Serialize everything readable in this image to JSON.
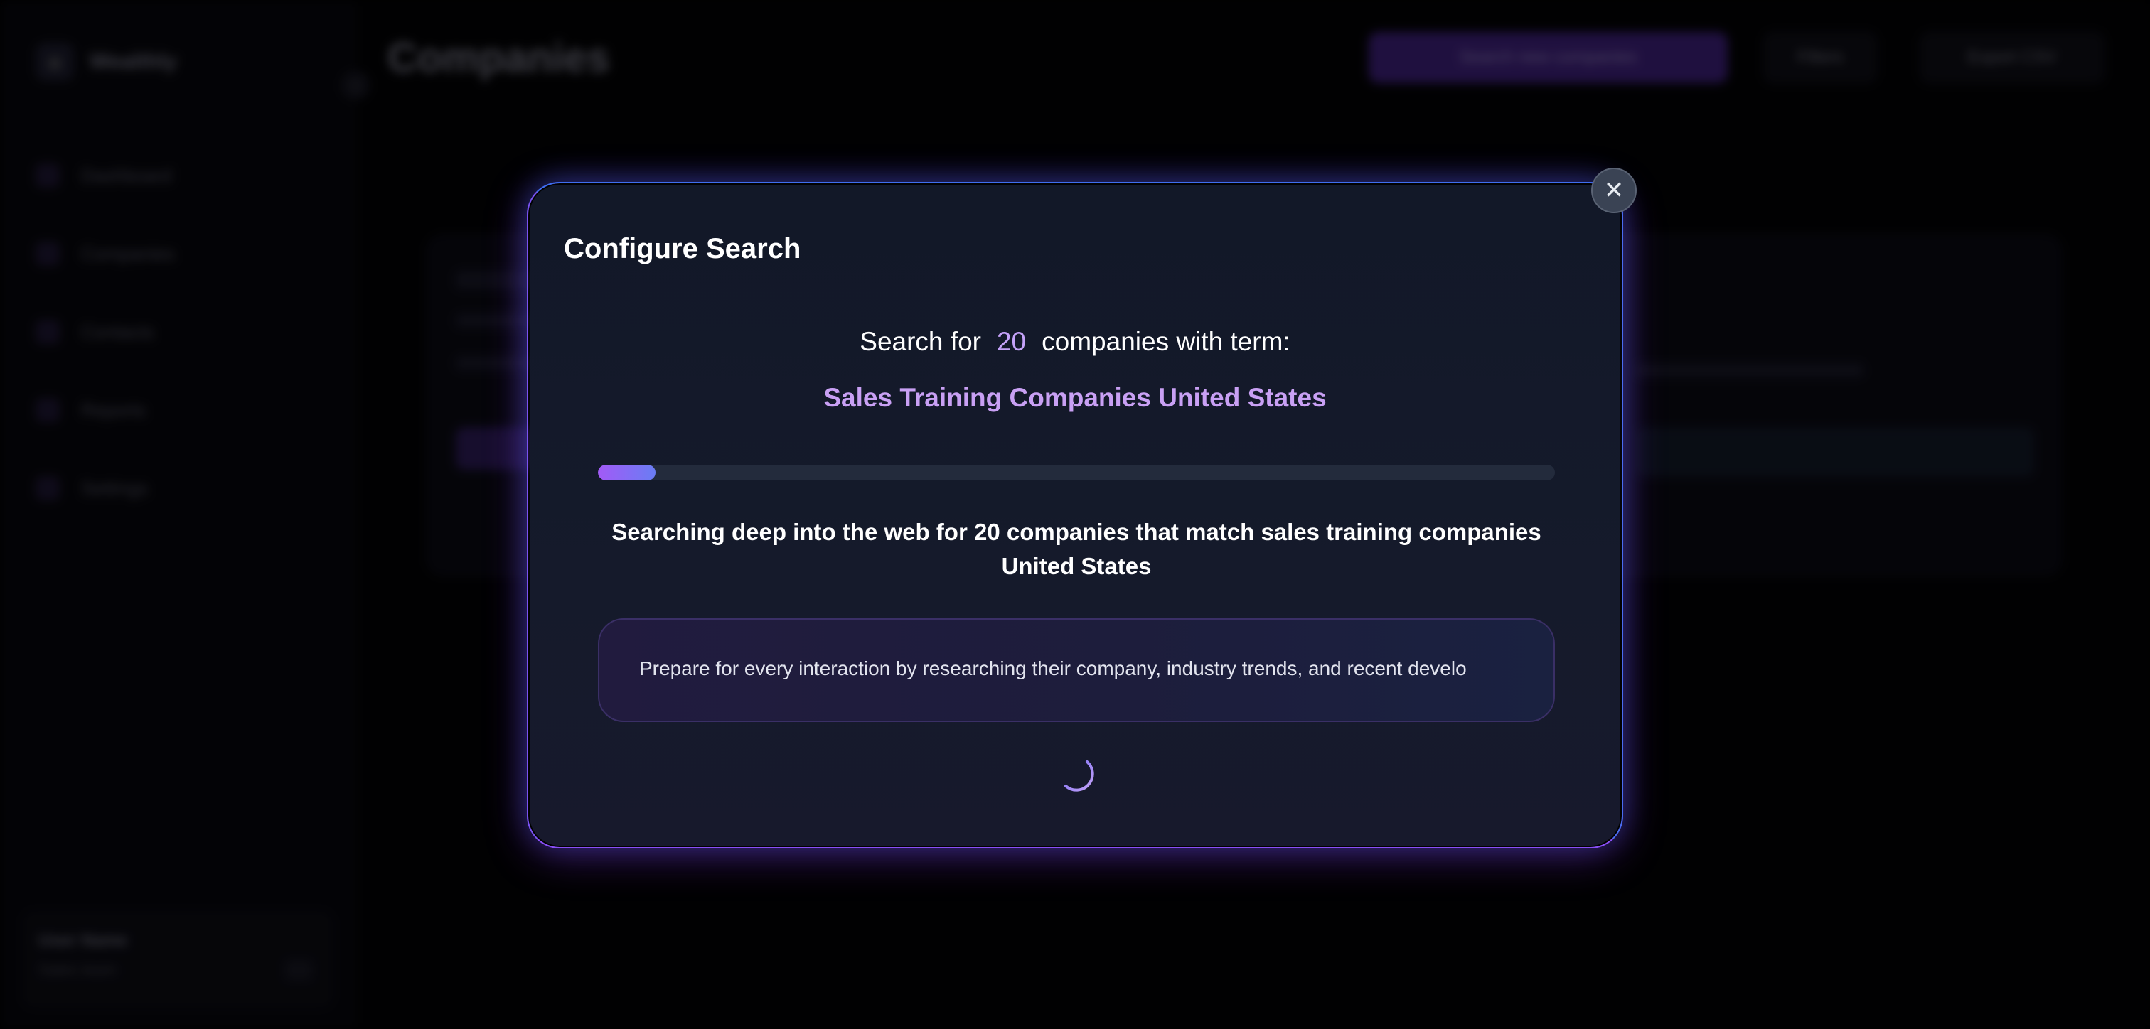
{
  "app": {
    "brand_name": "Wealthly",
    "page_title": "Companies",
    "nav_items": [
      {
        "label": "Dashboard",
        "icon": "grid-icon"
      },
      {
        "label": "Companies",
        "icon": "building-icon"
      },
      {
        "label": "Contacts",
        "icon": "users-icon"
      },
      {
        "label": "Reports",
        "icon": "chart-icon"
      },
      {
        "label": "Settings",
        "icon": "gear-icon"
      }
    ],
    "header_buttons": {
      "primary": "Search new companies",
      "secondary_1": "Filters",
      "secondary_2": "Export CSV"
    },
    "user": {
      "name": "User Name",
      "role": "Sales team"
    }
  },
  "modal": {
    "title": "Configure Search",
    "close_icon": "✕",
    "search_prefix": "Search for",
    "search_count": "20",
    "search_suffix": "companies with term:",
    "search_term": "Sales Training Companies United States",
    "progress": 0.06,
    "status": "Searching deep into the web for 20 companies that match sales training companies United States",
    "tip": "Prepare for every interaction by researching their company, industry trends, and recent develo"
  },
  "colors": {
    "accent_purple": "#c4a2f8",
    "progress_start": "#a25af6",
    "progress_end": "#6a7df4",
    "modal_bg": "#121828"
  }
}
